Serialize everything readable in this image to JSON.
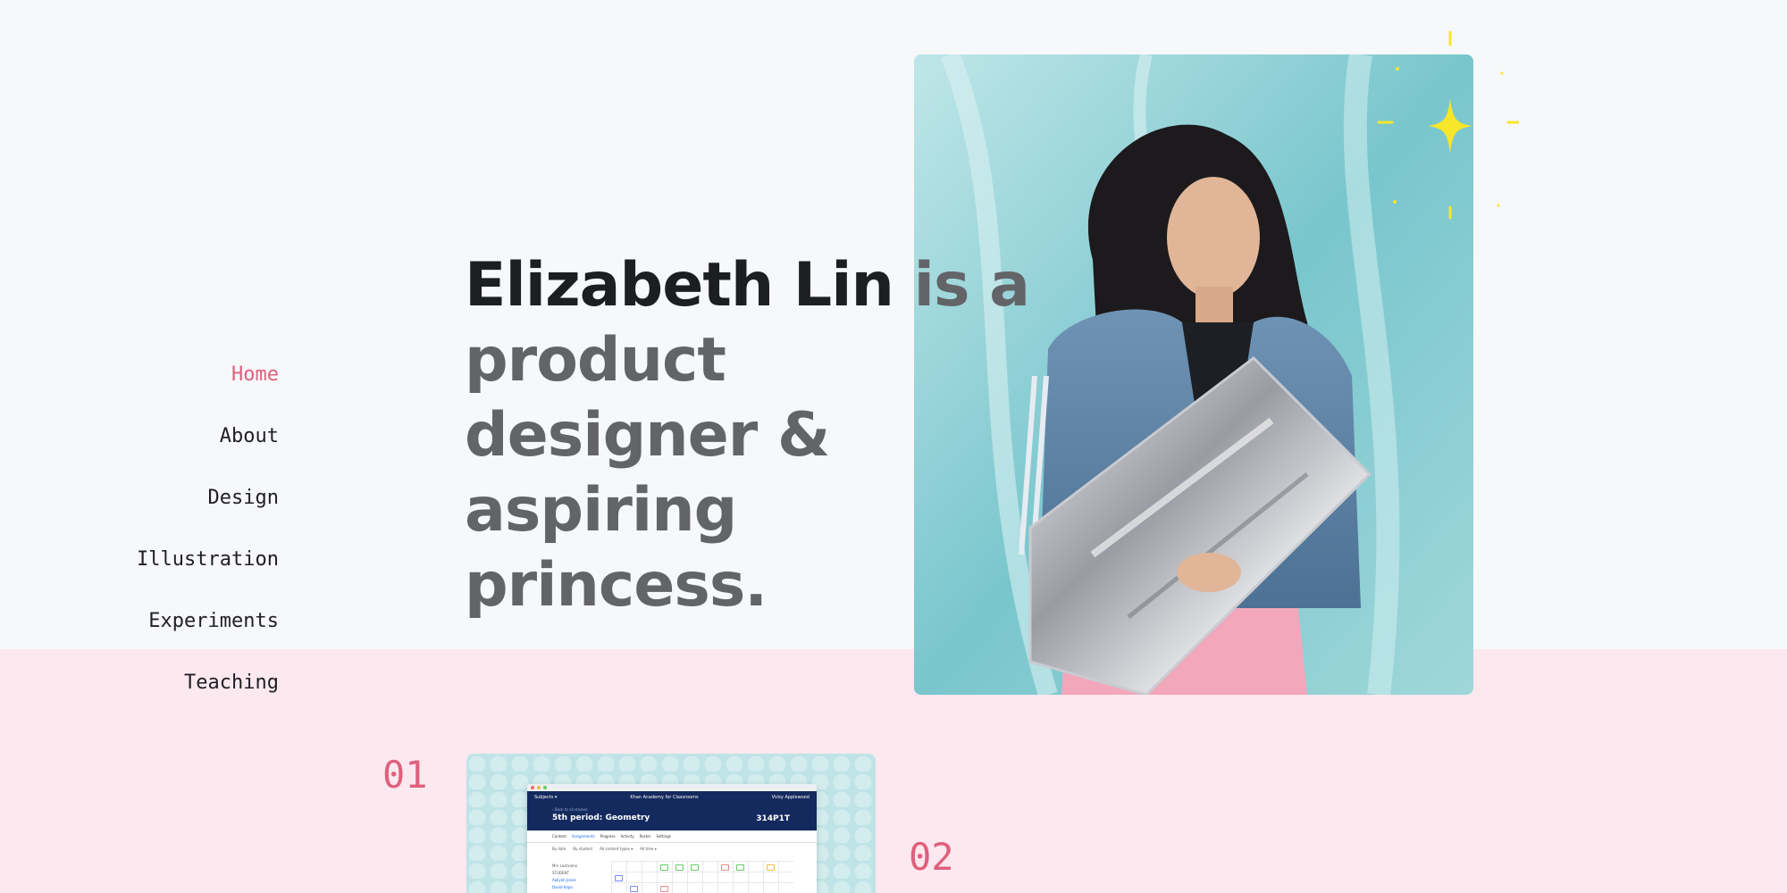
{
  "nav": {
    "items": [
      {
        "label": "Home",
        "active": true
      },
      {
        "label": "About",
        "active": false
      },
      {
        "label": "Design",
        "active": false
      },
      {
        "label": "Illustration",
        "active": false
      },
      {
        "label": "Experiments",
        "active": false
      },
      {
        "label": "Teaching",
        "active": false
      }
    ]
  },
  "hero": {
    "name": "Elizabeth Lin",
    "tagline": " is a product designer & aspiring princess."
  },
  "projects": [
    {
      "number": "01"
    },
    {
      "number": "02"
    }
  ],
  "thumbnail": {
    "topbar_left": "Subjects ▾",
    "topbar_center": "Khan Academy for Classrooms",
    "topbar_right": "Vicky Applewood",
    "breadcrumb": "‹ Back to all classes",
    "class_title": "5th period: Geometry",
    "class_code": "314P1T",
    "tabs": [
      "Content",
      "Assignments",
      "Progress",
      "Activity",
      "Roster",
      "Settings"
    ],
    "filters": [
      "By date",
      "By student",
      "All content types ▾",
      "All time ▾"
    ],
    "side_label": "Mrs Lastname",
    "side_items": [
      "STUDENT",
      "Aaliyah Jones",
      "David Kapo"
    ]
  },
  "colors": {
    "accent": "#e0607e",
    "page_bg": "#f7f8fa",
    "pink_band": "#fce8ef",
    "headline_name": "#1d1e22",
    "headline_rest": "#636468",
    "sparkle": "#f7e62a"
  }
}
